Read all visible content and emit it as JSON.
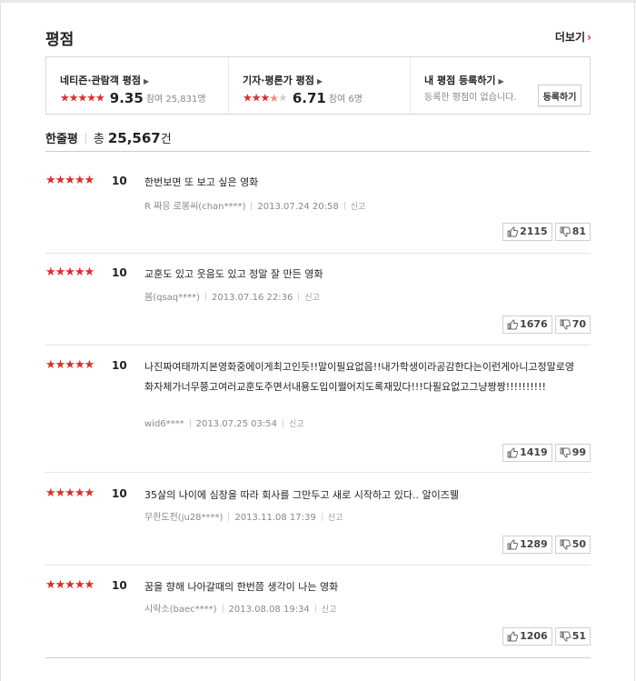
{
  "section": {
    "title": "평점",
    "more_label": "더보기",
    "more_arrow": "›"
  },
  "ratings": {
    "netizen": {
      "label": "네티즌·관람객 평점",
      "score": "9.35",
      "participants": "참여 25,831명",
      "stars": 5,
      "full_stars": 4,
      "half": true
    },
    "critic": {
      "label": "기자·평론가 평점",
      "score": "6.71",
      "participants": "참여 6명",
      "stars": 5,
      "full_stars": 3,
      "half": true
    },
    "mine": {
      "label": "내 평점 등록하기",
      "empty_text": "등록한 평점이 없습니다.",
      "button_label": "등록하기"
    }
  },
  "comments_header": {
    "title": "한줄평",
    "total_prefix": "총",
    "total": "25,567",
    "unit": "건"
  },
  "colors": {
    "accent": "#e02a2a",
    "star_off": "#cfcfcf"
  },
  "reviews": [
    {
      "score": "10",
      "text": "한번보면 또 보고 싶은 영화",
      "author": "R 짜응 로봉씨(chan****)",
      "date": "2013.07.24 20:58",
      "report": "신고",
      "likes": "2115",
      "dislikes": "81"
    },
    {
      "score": "10",
      "text": "교훈도 있고 웃음도 있고 정말 잘 만든 영화",
      "author": "봄(qsaq****)",
      "date": "2013.07.16 22:36",
      "report": "신고",
      "likes": "1676",
      "dislikes": "70"
    },
    {
      "score": "10",
      "text": "나진짜여태까지본영화중에이게최고인듯!!말이필요없음!!내가학생이라공감한다는이런게아니고정말로영화자체가너무쭁고여러교훈도주면서내용도입이쩔어지도록재밌다!!!다필요없고그냥짱짱!!!!!!!!!!",
      "author": "wid6****",
      "date": "2013.07.25 03:54",
      "report": "신고",
      "likes": "1419",
      "dislikes": "99"
    },
    {
      "score": "10",
      "text": "35살의 나이에 심장을 따라 회사를 그만두고 새로 시작하고 있다.. 알이즈웰",
      "author": "무한도전(ju28****)",
      "date": "2013.11.08 17:39",
      "report": "신고",
      "likes": "1289",
      "dislikes": "50"
    },
    {
      "score": "10",
      "text": "꿈을 향해 나아갈때의 한번쯤 생각이 나는 영화",
      "author": "시락소(baec****)",
      "date": "2013.08.08 19:34",
      "report": "신고",
      "likes": "1206",
      "dislikes": "51"
    }
  ]
}
